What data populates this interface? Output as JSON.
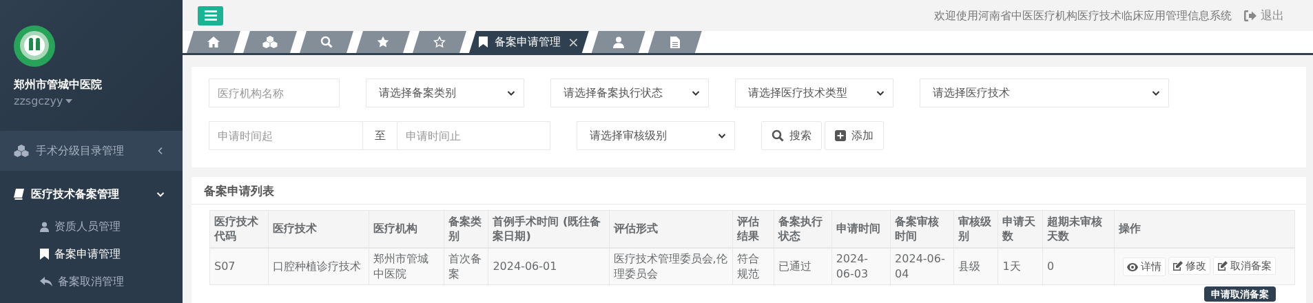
{
  "sidebar": {
    "org_name": "郑州市管城中医院",
    "username": "zzsgczyy",
    "menu": [
      {
        "label": "手术分级目录管理",
        "expanded": false,
        "hovered": true
      },
      {
        "label": "医疗技术备案管理",
        "expanded": true,
        "hovered": false,
        "children": [
          {
            "label": "资质人员管理",
            "selected": false
          },
          {
            "label": "备案申请管理",
            "selected": true
          },
          {
            "label": "备案取消管理",
            "selected": false
          }
        ]
      }
    ]
  },
  "topbar": {
    "welcome": "欢迎使用河南省中医医疗机构医疗技术临床应用管理信息系统",
    "logout": "退出"
  },
  "tabs": [
    {
      "selected": false
    },
    {
      "selected": false
    },
    {
      "selected": false
    },
    {
      "selected": false
    },
    {
      "selected": false
    },
    {
      "label": "备案申请管理",
      "close": "×",
      "selected": true
    },
    {
      "selected": false
    },
    {
      "selected": false
    }
  ],
  "filters": {
    "row1": [
      {
        "kind": "input",
        "placeholder": "医疗机构名称"
      },
      {
        "kind": "select",
        "value": "请选择备案类别"
      },
      {
        "kind": "select",
        "value": "请选择备案执行状态"
      },
      {
        "kind": "select",
        "value": "请选择医疗技术类型"
      },
      {
        "kind": "select",
        "value": "请选择医疗技术"
      }
    ],
    "row2": [
      {
        "kind": "daterange",
        "from_placeholder": "申请时间起",
        "separator": "至",
        "to_placeholder": "申请时间止"
      },
      {
        "kind": "select",
        "value": "请选择审核级别"
      },
      {
        "kind": "button",
        "label": "搜索"
      },
      {
        "kind": "button",
        "label": "添加"
      }
    ]
  },
  "table": {
    "title": "备案申请列表",
    "columns": [
      "医疗技术代码",
      "医疗技术",
      "医疗机构",
      "备案类别",
      "首例手术时间 (既往备案日期)",
      "评估形式",
      "评估结果",
      "备案执行状态",
      "申请时间",
      "备案审核时间",
      "审核级别",
      "申请天数",
      "超期未审核天数",
      "操作"
    ],
    "rows": [
      {
        "cells": [
          "S07",
          "口腔种植诊疗技术",
          "郑州市管城中医院",
          "首次备案",
          "2024-06-01",
          "医疗技术管理委员会,伦理委员会",
          "符合规范",
          "已通过",
          "2024-06-03",
          "2024-06-04",
          "县级",
          "1天",
          "0"
        ],
        "actions": [
          {
            "label": "详情"
          },
          {
            "label": "修改"
          },
          {
            "label": "取消备案"
          }
        ]
      }
    ]
  },
  "tooltip": "申请取消备案"
}
